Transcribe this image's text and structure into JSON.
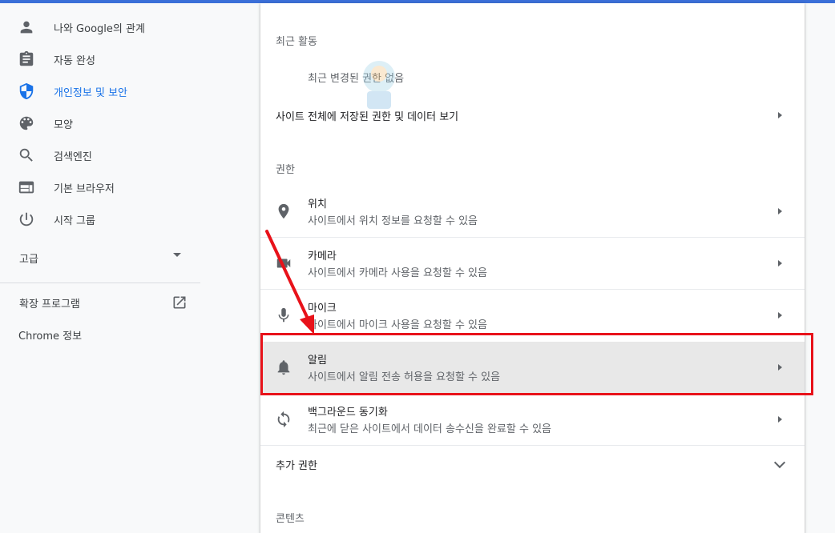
{
  "sidebar": {
    "items": [
      {
        "label": "나와 Google의 관계",
        "icon": "person-icon"
      },
      {
        "label": "자동 완성",
        "icon": "clipboard-icon"
      },
      {
        "label": "개인정보 및 보안",
        "icon": "shield-icon",
        "active": true
      },
      {
        "label": "모양",
        "icon": "palette-icon"
      },
      {
        "label": "검색엔진",
        "icon": "search-icon"
      },
      {
        "label": "기본 브라우저",
        "icon": "browser-icon"
      },
      {
        "label": "시작 그룹",
        "icon": "power-icon"
      }
    ],
    "advanced": "고급",
    "extensions": "확장 프로그램",
    "about": "Chrome 정보"
  },
  "main": {
    "recent_activity": {
      "title": "최근 활동",
      "empty_text": "최근 변경된 권한 없음"
    },
    "all_sites_row": "사이트 전체에 저장된 권한 및 데이터 보기",
    "permissions": {
      "title": "권한",
      "items": [
        {
          "title": "위치",
          "desc": "사이트에서 위치 정보를 요청할 수 있음",
          "icon": "location-pin-icon"
        },
        {
          "title": "카메라",
          "desc": "사이트에서 카메라 사용을 요청할 수 있음",
          "icon": "camera-icon"
        },
        {
          "title": "마이크",
          "desc": "사이트에서 마이크 사용을 요청할 수 있음",
          "icon": "microphone-icon"
        },
        {
          "title": "알림",
          "desc": "사이트에서 알림 전송 허용을 요청할 수 있음",
          "icon": "bell-icon",
          "highlighted": true
        },
        {
          "title": "백그라운드 동기화",
          "desc": "최근에 닫은 사이트에서 데이터 송수신을 완료할 수 있음",
          "icon": "sync-icon"
        }
      ]
    },
    "additional_permissions": "추가 권한",
    "content_title": "콘텐츠"
  },
  "colors": {
    "accent": "#1a73e8",
    "annotation": "#e8121a",
    "highlight_bg": "#e8e8e8",
    "top_bar": "#3b6fd8"
  }
}
